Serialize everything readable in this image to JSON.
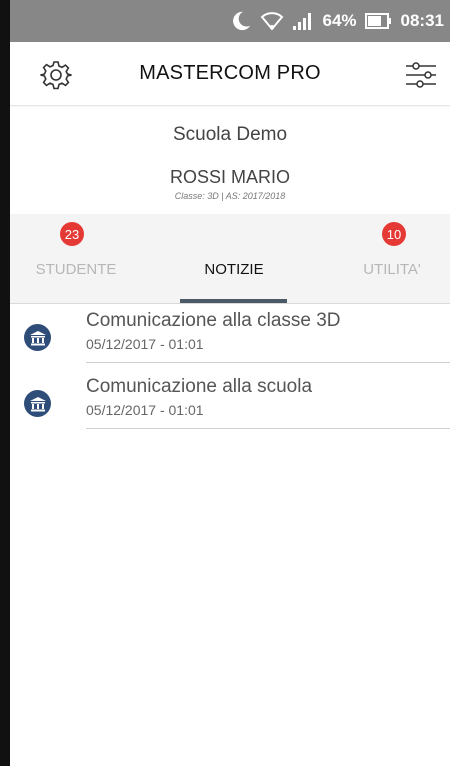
{
  "status_bar": {
    "battery_percent": "64%",
    "time": "08:31",
    "icons": [
      "moon-icon",
      "wifi-icon",
      "signal-icon",
      "battery-icon"
    ]
  },
  "header": {
    "title": "MASTERCOM PRO",
    "left_icon": "gear-icon",
    "right_icon": "filter-sliders-icon"
  },
  "school": {
    "name": "Scuola Demo",
    "student": "ROSSI MARIO",
    "class_info": "Classe: 3D | AS: 2017/2018"
  },
  "tabs": [
    {
      "label": "STUDENTE",
      "badge": "23",
      "active": false
    },
    {
      "label": "NOTIZIE",
      "active": true
    },
    {
      "label": "UTILITA'",
      "badge": "10",
      "active": false
    }
  ],
  "news": [
    {
      "title": "Comunicazione alla classe 3D",
      "date": "05/12/2017 - 01:01",
      "icon": "institution-icon"
    },
    {
      "title": "Comunicazione alla scuola",
      "date": "05/12/2017 - 01:01",
      "icon": "institution-icon"
    }
  ],
  "colors": {
    "status_bar": "#878787",
    "badge": "#e53935",
    "tab_indicator": "#4b5a66",
    "news_icon_bg": "#2e4d78"
  }
}
